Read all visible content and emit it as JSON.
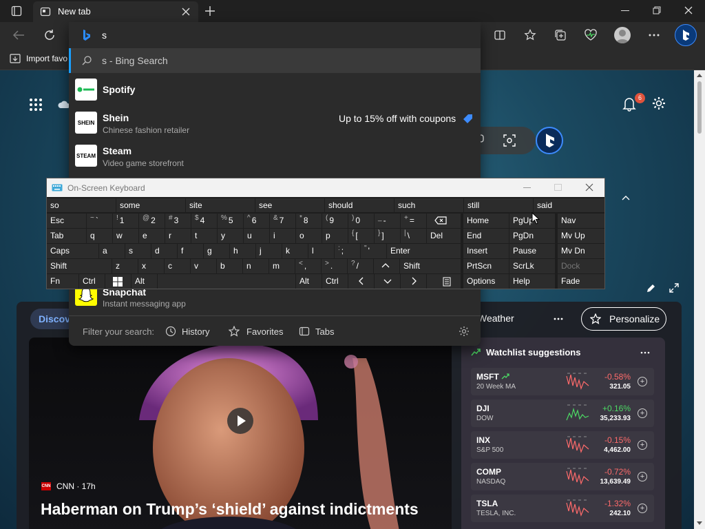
{
  "browser": {
    "tab_title": "New tab",
    "favorites_bar_item": "Import favo",
    "address_value": "s"
  },
  "omnibox": {
    "search_suggestion": "s - Bing Search",
    "suggestions": [
      {
        "title": "Spotify",
        "subtitle": "",
        "logo": "Spotify",
        "promo": ""
      },
      {
        "title": "Shein",
        "subtitle": "Chinese fashion retailer",
        "logo": "SHEIN",
        "promo": "Up to 15% off with coupons"
      },
      {
        "title": "Steam",
        "subtitle": "Video game storefront",
        "logo": "STEAM",
        "promo": ""
      },
      {
        "title": "Snapchat",
        "subtitle": "Instant messaging app",
        "logo": "",
        "promo": ""
      }
    ],
    "filter_label": "Filter your search:",
    "filters": [
      "History",
      "Favorites",
      "Tabs"
    ]
  },
  "osk": {
    "title": "On-Screen Keyboard",
    "predictions": [
      "so",
      "some",
      "site",
      "see",
      "should",
      "such",
      "still",
      "said"
    ],
    "row1": [
      [
        "Esc",
        ""
      ],
      [
        "`",
        "~"
      ],
      [
        "1",
        "!"
      ],
      [
        "2",
        "@"
      ],
      [
        "3",
        "#"
      ],
      [
        "4",
        "$"
      ],
      [
        "5",
        "%"
      ],
      [
        "6",
        "^"
      ],
      [
        "7",
        "&"
      ],
      [
        "8",
        "*"
      ],
      [
        "9",
        "("
      ],
      [
        "0",
        ")"
      ],
      [
        "-",
        "_"
      ],
      [
        "=",
        "+"
      ]
    ],
    "row2": [
      "Tab",
      "q",
      "w",
      "e",
      "r",
      "t",
      "y",
      "u",
      "i",
      "o",
      "p",
      "[",
      "]",
      "\\",
      "Del"
    ],
    "row2_shift": [
      "",
      "",
      "",
      "",
      "",
      "",
      "",
      "",
      "",
      "",
      "",
      "{",
      "}",
      "|",
      ""
    ],
    "row3": [
      "Caps",
      "a",
      "s",
      "d",
      "f",
      "g",
      "h",
      "j",
      "k",
      "l",
      ";",
      "'",
      "Enter"
    ],
    "row3_shift": [
      "",
      "",
      "",
      "",
      "",
      "",
      "",
      "",
      "",
      "",
      ":",
      "\"",
      ""
    ],
    "row4": [
      "Shift",
      "z",
      "x",
      "c",
      "v",
      "b",
      "n",
      "m",
      ",",
      ".",
      "/",
      "",
      "Shift"
    ],
    "row4_shift": [
      "",
      "",
      "",
      "",
      "",
      "",
      "",
      "",
      "<",
      ">",
      "?",
      "",
      ""
    ],
    "row5": [
      "Fn",
      "Ctrl",
      "",
      "Alt",
      "",
      "Alt",
      "Ctrl"
    ],
    "nav_left": [
      "Home",
      "End",
      "Insert",
      "PrtScn",
      "Options"
    ],
    "nav_mid": [
      "PgUp",
      "PgDn",
      "Pause",
      "ScrLk",
      "Help"
    ],
    "nav_right": [
      "Nav",
      "Mv Up",
      "Mv Dn",
      "Dock",
      "Fade"
    ]
  },
  "newtab": {
    "notifications_count": "6",
    "discover_label": "Discov",
    "weather_label": "Weather",
    "personalize_label": "Personalize",
    "watchlist_title": "Watchlist suggestions",
    "stocks": [
      {
        "symbol": "MSFT",
        "sub": "20 Week MA",
        "change": "-0.58%",
        "value": "321.05",
        "up": false
      },
      {
        "symbol": "DJI",
        "sub": "DOW",
        "change": "+0.16%",
        "value": "35,233.93",
        "up": true
      },
      {
        "symbol": "INX",
        "sub": "S&P 500",
        "change": "-0.15%",
        "value": "4,462.00",
        "up": false
      },
      {
        "symbol": "COMP",
        "sub": "NASDAQ",
        "change": "-0.72%",
        "value": "13,639.49",
        "up": false
      },
      {
        "symbol": "TSLA",
        "sub": "TESLA, INC.",
        "change": "-1.32%",
        "value": "242.10",
        "up": false
      }
    ],
    "story_source": "CNN · 17h",
    "story_source_logo": "CNN",
    "story_headline": "Haberman on Trump’s ‘shield’ against indictments"
  },
  "colors": {
    "accent_blue": "#1a9fff",
    "down_red": "#ff6b6b",
    "up_green": "#4cd964",
    "promo_blue": "#3d8bfd"
  }
}
